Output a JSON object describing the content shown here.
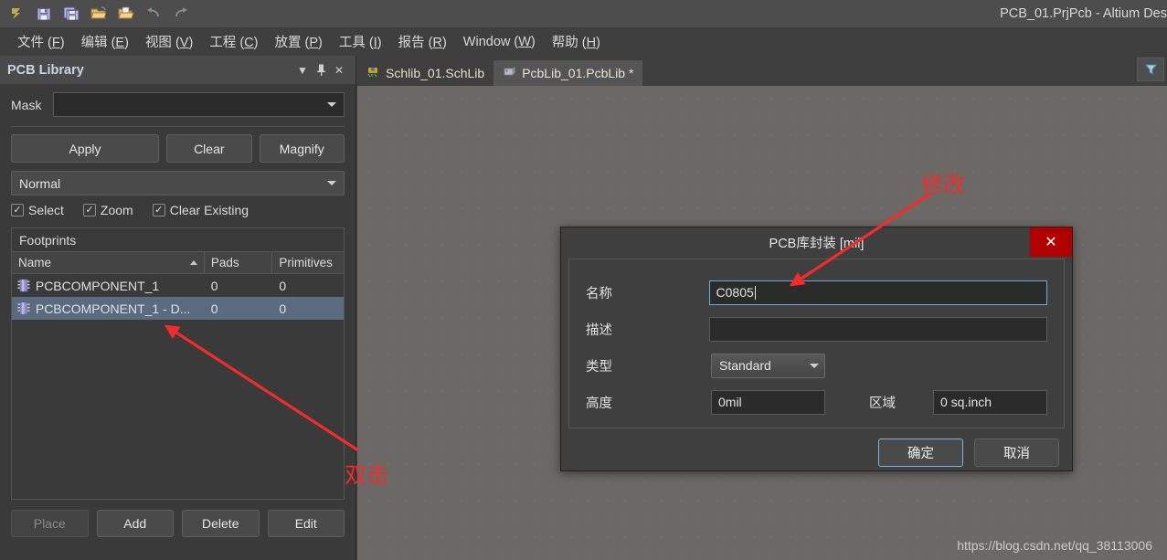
{
  "window": {
    "title": "PCB_01.PrjPcb - Altium Des",
    "toolbar_icons": [
      "altium-logo-icon",
      "save-icon",
      "save-all-icon",
      "open-icon",
      "open-project-icon",
      "undo-icon",
      "redo-icon"
    ]
  },
  "menubar": {
    "items": [
      {
        "label": "文件",
        "key": "F"
      },
      {
        "label": "编辑",
        "key": "E"
      },
      {
        "label": "视图",
        "key": "V"
      },
      {
        "label": "工程",
        "key": "C"
      },
      {
        "label": "放置",
        "key": "P"
      },
      {
        "label": "工具",
        "key": "I"
      },
      {
        "label": "报告",
        "key": "R"
      },
      {
        "label": "Window",
        "key": "W"
      },
      {
        "label": "帮助",
        "key": "H"
      }
    ]
  },
  "panel": {
    "title": "PCB Library",
    "header_buttons": [
      "dropdown-icon",
      "pin-icon",
      "close-icon"
    ],
    "mask": {
      "label": "Mask",
      "value": ""
    },
    "buttons": {
      "apply": "Apply",
      "clear": "Clear",
      "magnify": "Magnify"
    },
    "mode": {
      "value": "Normal"
    },
    "checkboxes": [
      {
        "label": "Select",
        "checked": true
      },
      {
        "label": "Zoom",
        "checked": true
      },
      {
        "label": "Clear Existing",
        "checked": true
      }
    ],
    "footprints": {
      "title": "Footprints",
      "columns": [
        "Name",
        "Pads",
        "Primitives"
      ],
      "sort_column": "Name",
      "sort_dir": "asc",
      "rows": [
        {
          "name": "PCBCOMPONENT_1",
          "pads": "0",
          "primitives": "0",
          "selected": false
        },
        {
          "name": "PCBCOMPONENT_1 - D...",
          "pads": "0",
          "primitives": "0",
          "selected": true
        }
      ]
    },
    "bottom_buttons": [
      {
        "label": "Place",
        "disabled": true
      },
      {
        "label": "Add",
        "disabled": false
      },
      {
        "label": "Delete",
        "disabled": false
      },
      {
        "label": "Edit",
        "disabled": false
      }
    ]
  },
  "editor": {
    "tabs": [
      {
        "label": "Schlib_01.SchLib",
        "active": false,
        "icon": "schematic-lib-icon"
      },
      {
        "label": "PcbLib_01.PcbLib *",
        "active": true,
        "icon": "pcb-lib-icon"
      }
    ],
    "filter_button_icon": "filter-funnel-icon",
    "watermark": "https://blog.csdn.net/qq_38113006"
  },
  "dialog": {
    "title": "PCB库封装 [mil]",
    "close_label": "✕",
    "fields": {
      "name_label": "名称",
      "name_value": "C0805",
      "desc_label": "描述",
      "desc_value": "",
      "type_label": "类型",
      "type_value": "Standard",
      "height_label": "高度",
      "height_value": "0mil",
      "area_label": "区域",
      "area_value": "0 sq.inch"
    },
    "ok_label": "确定",
    "cancel_label": "取消"
  },
  "annotations": [
    {
      "text": "修改",
      "color": "#f22c2c"
    },
    {
      "text": "双击",
      "color": "#f22c2c"
    }
  ],
  "colors": {
    "accent_red": "#f22c2c",
    "close_red": "#b00000",
    "selection_blue": "#5a6b80",
    "focus_blue": "#6fa8dc",
    "canvas": "#6b6865"
  }
}
